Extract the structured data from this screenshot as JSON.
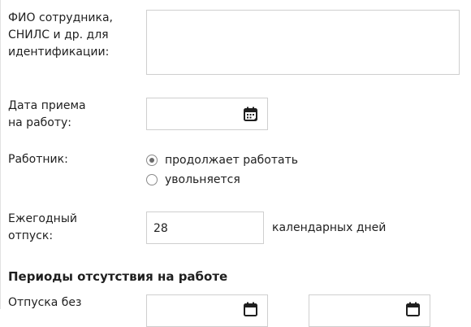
{
  "form": {
    "employee_id": {
      "label_lines": [
        "ФИО сотрудника,",
        "СНИЛС и др. для",
        "идентификации:"
      ],
      "value": ""
    },
    "hire_date": {
      "label_lines": [
        "Дата приема",
        "на работу:"
      ],
      "value": "",
      "icon": "calendar-icon"
    },
    "worker": {
      "label": "Работник:",
      "options": [
        {
          "label": "продолжает работать",
          "checked": true
        },
        {
          "label": "увольняется",
          "checked": false
        }
      ]
    },
    "annual_leave": {
      "label_lines": [
        "Ежегодный",
        "отпуск:"
      ],
      "value": "28",
      "unit": "календарных дней"
    }
  },
  "absence_section": {
    "heading": "Периоды отсутствия на работе",
    "unpaid_leave": {
      "label_visible": "Отпуска без",
      "icon": "calendar-icon"
    }
  },
  "colors": {
    "border": "#cfcfcf",
    "text": "#1f1f1f",
    "icon": "#1f1f1f"
  }
}
